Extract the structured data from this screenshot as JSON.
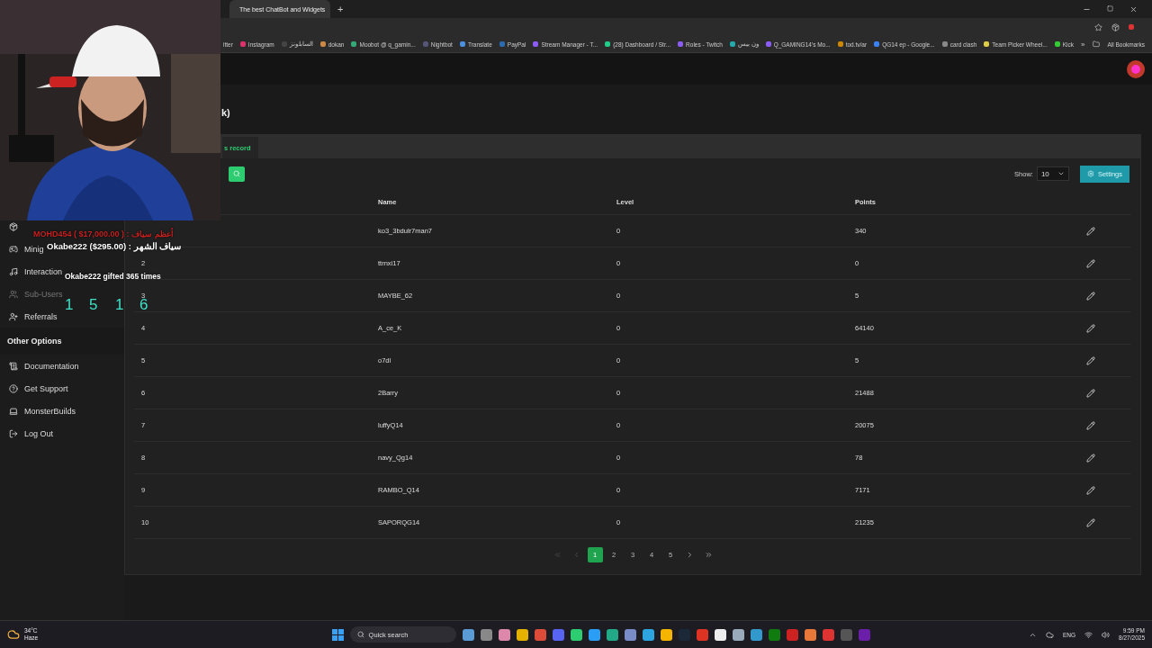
{
  "browser": {
    "tabs": [
      {
        "title": "The best ChatBot and Widgets",
        "selected": true
      }
    ],
    "new_tab": "+",
    "bookmarks": [
      "itter",
      "Instagram",
      "السابلونز",
      "dokan",
      "Moobot @ q_gamin...",
      "Nightbot",
      "Translate",
      "PayPal",
      "Stream Manager - T...",
      "(28) Dashboard / Str...",
      "Roles - Twitch",
      "ون بيس",
      "Q_GAMING14's Mo...",
      "tod.tv/ar",
      "QG14 ep - Google...",
      "card clash",
      "Team Picker Wheel...",
      "Kick"
    ],
    "more_bookmarks": "»",
    "all_bookmarks": "All Bookmarks"
  },
  "stream_overlay": {
    "lines": [
      {
        "kind": "alert",
        "text": "MOHD454 ( $17,000.00 ) : أعظم سياف"
      },
      {
        "kind": "donor",
        "text": "Okabe222  ($295.00) : سياف الشهر"
      },
      {
        "kind": "gift",
        "text": "Okabe222 gifted 365 times"
      }
    ],
    "counter": [
      "1",
      "5",
      "1",
      "6"
    ]
  },
  "sidebar": {
    "items": [
      {
        "label": "Minig",
        "disabled": false
      },
      {
        "label": "Interaction",
        "disabled": false
      },
      {
        "label": "Sub-Users",
        "disabled": true
      },
      {
        "label": "Referrals",
        "disabled": false
      }
    ],
    "section": "Other Options",
    "other_items": [
      {
        "label": "Documentation"
      },
      {
        "label": "Get Support"
      },
      {
        "label": "MonsterBuilds"
      },
      {
        "label": "Log Out"
      }
    ]
  },
  "page": {
    "title": "k)",
    "tab": "s record",
    "show_label": "Show:",
    "show_value": "10",
    "settings_button": "Settings"
  },
  "table": {
    "columns": [
      "Name",
      "Level",
      "Points"
    ],
    "rows": [
      {
        "name": "ko3_3bdulr7man7",
        "level": "0",
        "points": "340"
      },
      {
        "rank": "2",
        "name": "ttrnxi17",
        "level": "0",
        "points": "0"
      },
      {
        "rank": "3",
        "name": "MAYBE_62",
        "level": "0",
        "points": "5"
      },
      {
        "rank": "4",
        "name": "A_ce_K",
        "level": "0",
        "points": "64140"
      },
      {
        "rank": "5",
        "name": "o7dl",
        "level": "0",
        "points": "5"
      },
      {
        "rank": "6",
        "name": "2Barry",
        "level": "0",
        "points": "21488"
      },
      {
        "rank": "7",
        "name": "luffyQ14",
        "level": "0",
        "points": "20075"
      },
      {
        "rank": "8",
        "name": "navy_Qg14",
        "level": "0",
        "points": "78"
      },
      {
        "rank": "9",
        "name": "RAMBO_Q14",
        "level": "0",
        "points": "7171"
      },
      {
        "rank": "10",
        "name": "SAPORQG14",
        "level": "0",
        "points": "21235"
      }
    ]
  },
  "pagination": {
    "pages": [
      {
        "label": "1",
        "selected": true
      },
      {
        "label": "2",
        "selected": false
      },
      {
        "label": "3",
        "selected": false
      },
      {
        "label": "4",
        "selected": false
      },
      {
        "label": "5",
        "selected": false
      }
    ]
  },
  "taskbar": {
    "temperature": "34°C",
    "weather": "Haze",
    "search": "Quick search",
    "language": "ENG",
    "time": "9:59 PM",
    "date": "8/27/2025"
  }
}
